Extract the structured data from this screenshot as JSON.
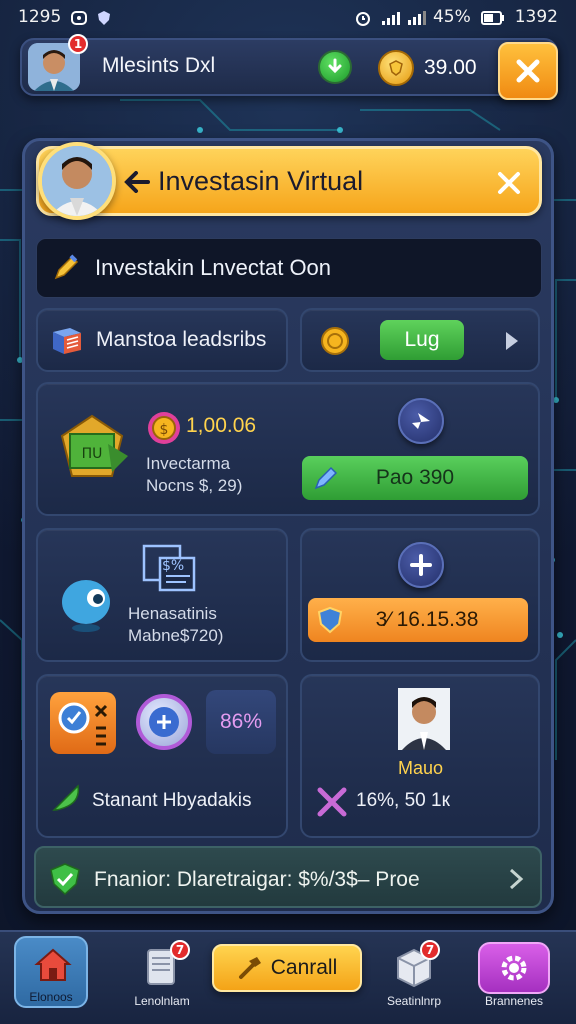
{
  "status_bar": {
    "time": "1295",
    "battery": "45%",
    "clock_right": "1392"
  },
  "header": {
    "username": "Mlesints Dxl",
    "notification_count": "1",
    "coin_balance": "39.00"
  },
  "dialog": {
    "title": "Investasin Virtual",
    "subtitle": "Investakin Lnvectat Oon"
  },
  "cards": {
    "leaderboard": {
      "label": "Manstoa leadsribs"
    },
    "login": {
      "button_label": "Lug"
    },
    "investment": {
      "coin_amount": "1,00.06",
      "line1": "Invectarma",
      "line2": "Nocns $, 29)",
      "action_label": "Pao 390"
    },
    "history": {
      "line1": "Henasatinis",
      "line2": "Mabne$720)"
    },
    "add": {
      "button_label": "3⁄ 16.15.38"
    },
    "stats": {
      "percent": "86%",
      "bottom_label": "Stanant Hbyadakis"
    },
    "profile": {
      "name": "Mauo",
      "stats": "16%, 50 1к"
    }
  },
  "footer": {
    "text": "Fnanior: Dlaretraigar: $%/3$– Proe"
  },
  "bottom_nav": {
    "home_label": "Elonoos",
    "item2_label": "Lenolnlam",
    "item2_badge": "7",
    "cancel_label": "Canrall",
    "item4_label": "Seatinlnrp",
    "item4_badge": "7",
    "item5_label": "Brannenes"
  },
  "colors": {
    "accent_orange": "#f6a51b",
    "accent_green": "#3fbf46",
    "panel_bg": "#1f2c4c",
    "background": "#0f1830"
  },
  "icons": {
    "status": [
      "alarm-icon",
      "signal-icon",
      "battery-icon"
    ],
    "header": [
      "download-icon",
      "coin-icon",
      "close-icon"
    ],
    "dialog": [
      "back-arrow-icon",
      "close-icon",
      "pencil-icon"
    ]
  }
}
